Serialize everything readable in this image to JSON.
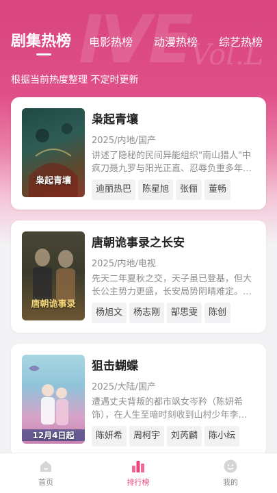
{
  "tabs": [
    {
      "label": "剧集热榜",
      "active": true
    },
    {
      "label": "电影热榜",
      "active": false
    },
    {
      "label": "动漫热榜",
      "active": false
    },
    {
      "label": "综艺热榜",
      "active": false
    }
  ],
  "subtitle": "根据当前热度整理 不定时更新",
  "shows": [
    {
      "title": "枭起青壤",
      "meta": "2025/内地/国产",
      "description": "讲述了隐秘的民间异能组织\"南山猎人\"中疯刀聂九罗与阳光正直、忍辱负重多年…",
      "tags": [
        "迪丽热巴",
        "陈星旭",
        "张俪",
        "董畅"
      ],
      "poster_text": "枭起青壤",
      "poster_colors": [
        "#2e5d55",
        "#8a3a2e"
      ]
    },
    {
      "title": "唐朝诡事录之长安",
      "meta": "2025/内地/电视",
      "description": "先天二年夏秋之交，天子虽已登基，但大长公主势力更盛，长安局势阴晴难定。…",
      "tags": [
        "杨旭文",
        "杨志刚",
        "郜思雯",
        "陈创"
      ],
      "poster_text": "唐朝诡事录",
      "poster_colors": [
        "#3a3a2c",
        "#6b5532"
      ]
    },
    {
      "title": "狙击蝴蝶",
      "meta": "2025/大陆/国产",
      "description": "遭遇丈夫背叛的都市飒女岑矜（陈妍希饰），在人生至暗时刻收到山村少年李…",
      "tags": [
        "陈妍希",
        "周柯宇",
        "刘芮麟",
        "陈小纭"
      ],
      "poster_text": "12月4日起",
      "poster_colors": [
        "#8fc4d9",
        "#c77fb0"
      ]
    }
  ],
  "nav": [
    {
      "label": "首页",
      "icon": "home-icon",
      "active": false
    },
    {
      "label": "排行榜",
      "icon": "ranking-icon",
      "active": true
    },
    {
      "label": "我的",
      "icon": "profile-icon",
      "active": false
    }
  ],
  "colors": {
    "accent": "#e8467d",
    "hero": "#d9457e"
  }
}
